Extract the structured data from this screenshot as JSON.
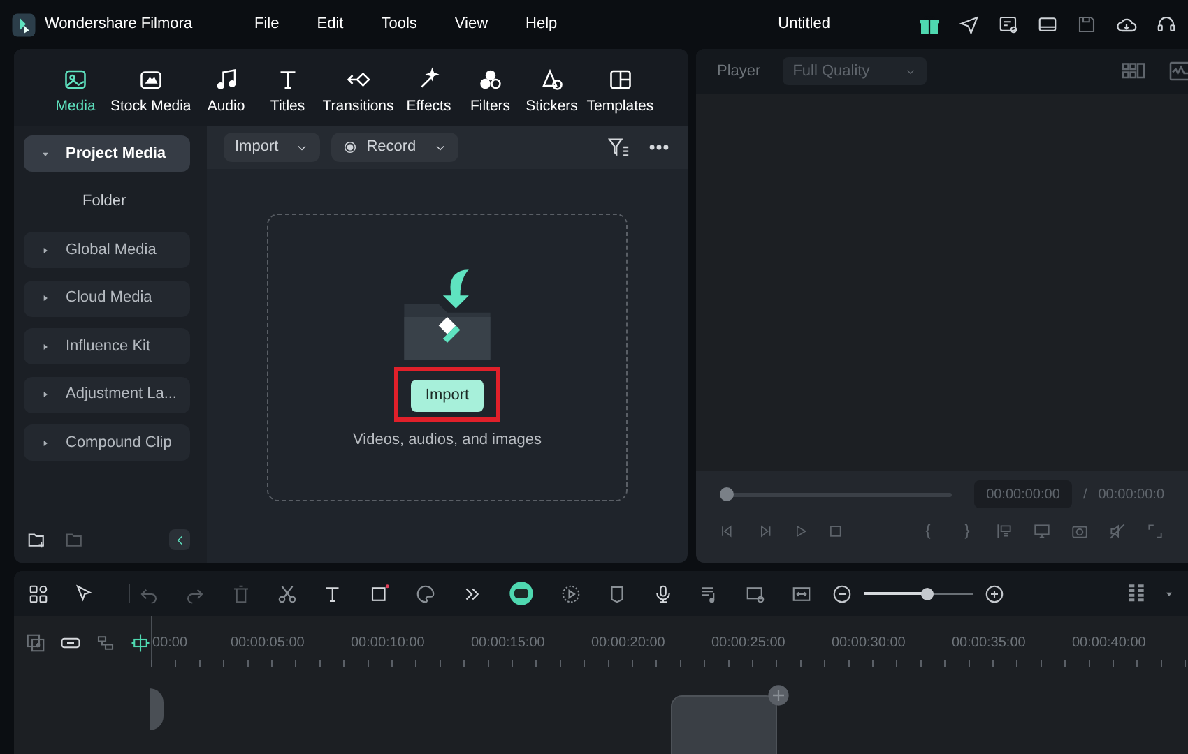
{
  "app": {
    "name": "Wondershare Filmora",
    "menus": [
      "File",
      "Edit",
      "Tools",
      "View",
      "Help"
    ],
    "document_title": "Untitled"
  },
  "tabs": [
    {
      "label": "Media",
      "selected": true
    },
    {
      "label": "Stock Media",
      "selected": false
    },
    {
      "label": "Audio",
      "selected": false
    },
    {
      "label": "Titles",
      "selected": false
    },
    {
      "label": "Transitions",
      "selected": false
    },
    {
      "label": "Effects",
      "selected": false
    },
    {
      "label": "Filters",
      "selected": false
    },
    {
      "label": "Stickers",
      "selected": false
    },
    {
      "label": "Templates",
      "selected": false
    }
  ],
  "sidebar": {
    "items": [
      {
        "label": "Project Media",
        "kind": "group",
        "expanded": true,
        "selected": true
      },
      {
        "label": "Folder",
        "kind": "folder",
        "selected": false
      },
      {
        "label": "Global Media",
        "kind": "group",
        "expanded": false,
        "selected": false
      },
      {
        "label": "Cloud Media",
        "kind": "group",
        "expanded": false,
        "selected": false
      },
      {
        "label": "Influence Kit",
        "kind": "group",
        "expanded": false,
        "selected": false
      },
      {
        "label": "Adjustment La...",
        "kind": "group",
        "expanded": false,
        "selected": false
      },
      {
        "label": "Compound Clip",
        "kind": "group",
        "expanded": false,
        "selected": false
      }
    ]
  },
  "media_toolbar": {
    "import": "Import",
    "record": "Record"
  },
  "drop_zone": {
    "button": "Import",
    "hint": "Videos, audios, and images"
  },
  "player": {
    "label": "Player",
    "quality": "Full Quality",
    "progress": {
      "level": 0
    },
    "current_time": "00:00:00:00",
    "separator": "/",
    "total_time": "00:00:00:0"
  },
  "timeline": {
    "zoom": {
      "level": 0.6
    },
    "ruler": [
      "00:00",
      "00:00:05:00",
      "00:00:10:00",
      "00:00:15:00",
      "00:00:20:00",
      "00:00:25:00",
      "00:00:30:00",
      "00:00:35:00",
      "00:00:40:00"
    ]
  }
}
